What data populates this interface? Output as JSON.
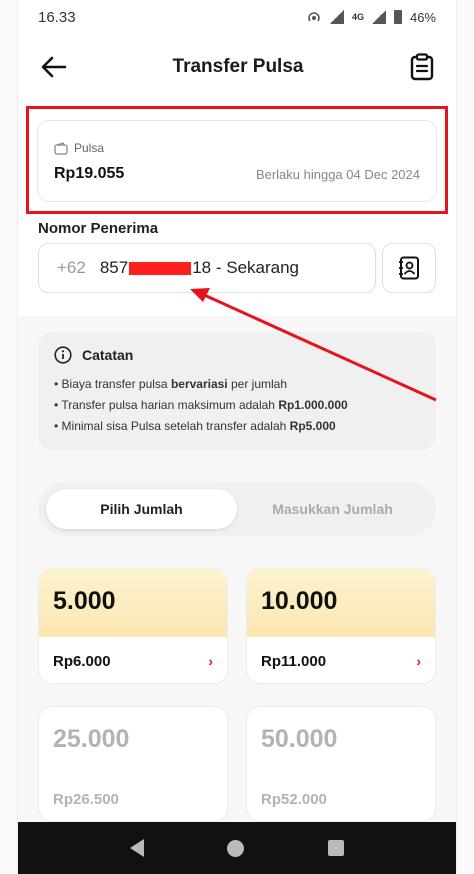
{
  "status_bar": {
    "time": "16.33",
    "network": "4G",
    "battery": "46%"
  },
  "header": {
    "title": "Transfer Pulsa",
    "back_icon": "arrow-left-icon",
    "history_icon": "clipboard-icon"
  },
  "balance": {
    "label": "Pulsa",
    "amount": "Rp19.055",
    "validity": "Berlaku hingga 04 Dec 2024",
    "highlight_color": "#e3141e"
  },
  "recipient": {
    "label": "Nomor Penerima",
    "country_code": "+62",
    "number_start": "857",
    "number_end": "18 - Sekarang",
    "contact_icon": "contact-book-icon"
  },
  "notes": {
    "title": "Catatan",
    "items": [
      {
        "pre": "Biaya transfer pulsa ",
        "bold": "bervariasi",
        "post": " per jumlah"
      },
      {
        "pre": "Transfer pulsa harian maksimum adalah ",
        "bold": "Rp1.000.000",
        "post": ""
      },
      {
        "pre": "Minimal sisa Pulsa setelah transfer adalah ",
        "bold": "Rp5.000",
        "post": ""
      }
    ]
  },
  "tabs": [
    {
      "label": "Pilih Jumlah",
      "active": true
    },
    {
      "label": "Masukkan Jumlah",
      "active": false
    }
  ],
  "options": [
    {
      "nominal": "5.000",
      "price": "Rp6.000",
      "enabled": true
    },
    {
      "nominal": "10.000",
      "price": "Rp11.000",
      "enabled": true
    },
    {
      "nominal": "25.000",
      "price": "Rp26.500",
      "enabled": false
    },
    {
      "nominal": "50.000",
      "price": "Rp52.000",
      "enabled": false
    }
  ],
  "colors": {
    "accent": "#e3141e",
    "tile_gradient_top": "#fdf3cf",
    "tile_gradient_bottom": "#fbe7b2"
  }
}
